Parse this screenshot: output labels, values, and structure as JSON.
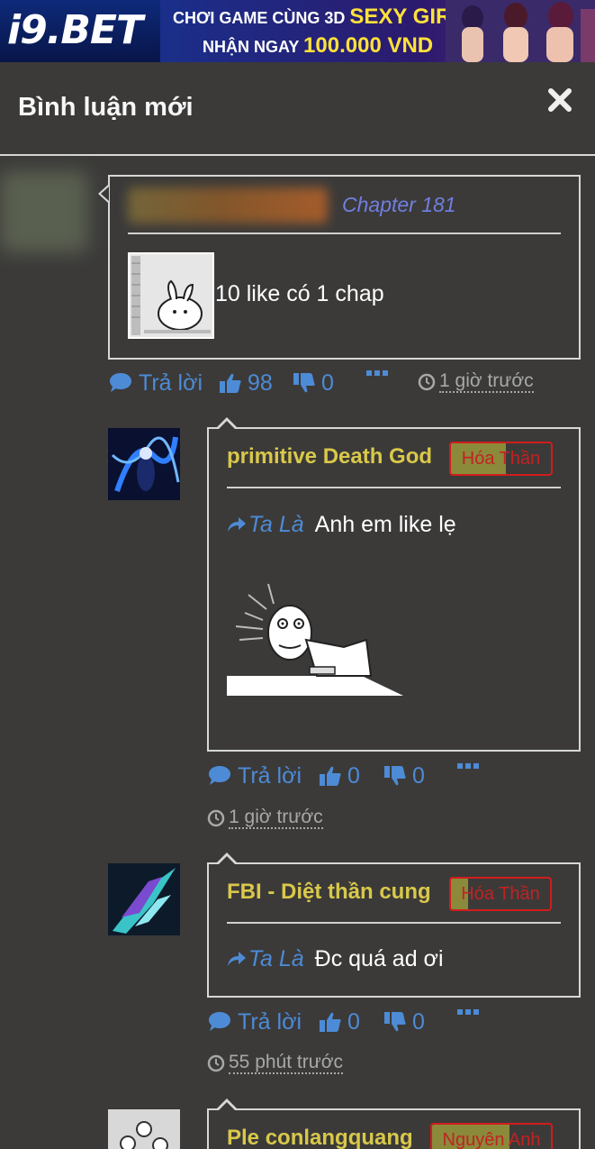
{
  "banner": {
    "logo": "i9.BET",
    "promo_line1_prefix": "CHƠI GAME CÙNG 3D",
    "promo_line1_highlight": "SEXY GIRL",
    "promo_line2_prefix": "NHẬN NGAY",
    "promo_line2_highlight": "100.000 VND"
  },
  "header": {
    "title": "Bình luận mới"
  },
  "top_comment": {
    "chapter": "Chapter 181",
    "text": "10 like có 1 chap",
    "reply_label": "Trả lời",
    "likes": "98",
    "dislikes": "0",
    "time": "1 giờ trước"
  },
  "replies": [
    {
      "username": "primitive Death God",
      "rank": "Hóa Thần",
      "rank_progress": 0.55,
      "reply_to": "Ta Là",
      "message": "Anh em like lẹ",
      "reply_label": "Trả lời",
      "likes": "0",
      "dislikes": "0",
      "time": "1 giờ trước"
    },
    {
      "username": "FBI - Diệt thần cung",
      "rank": "Hóa Thần",
      "rank_progress": 0.17,
      "reply_to": "Ta Là",
      "message": "Đc quá ad ơi",
      "reply_label": "Trả lời",
      "likes": "0",
      "dislikes": "0",
      "time": "55 phút trước"
    },
    {
      "username": "Ple conlangquang",
      "rank": "Nguyên Anh",
      "rank_progress": 0.65
    }
  ],
  "colors": {
    "background": "#3b3a39",
    "link_blue": "#4d8bd6",
    "chapter_blue": "#6f7fe0",
    "username_yellow": "#d9c84a",
    "badge_red": "#d21c1c"
  },
  "icons": [
    "close-icon",
    "comment-icon",
    "thumbs-up-icon",
    "thumbs-down-icon",
    "more-icon",
    "clock-icon",
    "reply-arrow-icon"
  ]
}
